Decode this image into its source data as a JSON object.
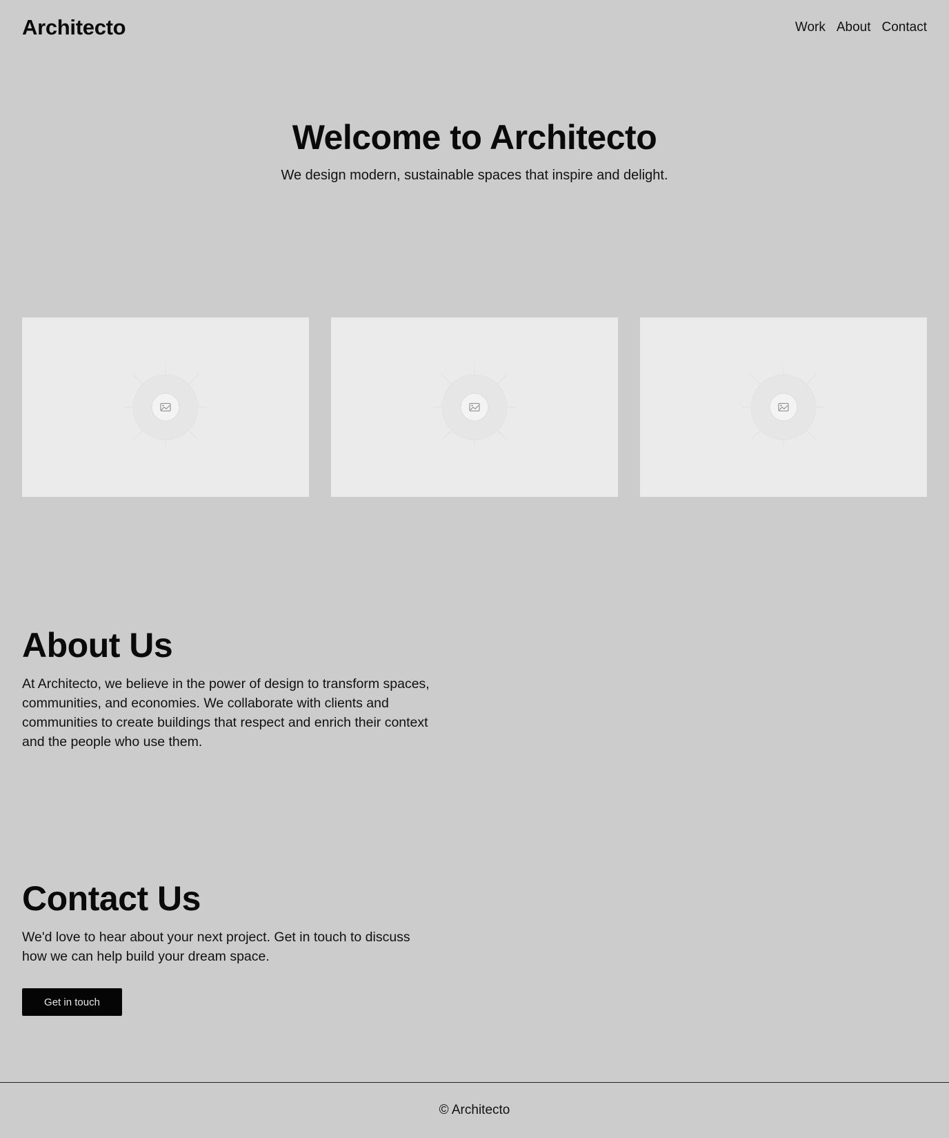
{
  "header": {
    "logo": "Architecto",
    "nav": [
      "Work",
      "About",
      "Contact"
    ]
  },
  "hero": {
    "title": "Welcome to Architecto",
    "subtitle": "We design modern, sustainable spaces that inspire and delight."
  },
  "gallery": {
    "items": [
      {
        "icon": "image-placeholder-icon"
      },
      {
        "icon": "image-placeholder-icon"
      },
      {
        "icon": "image-placeholder-icon"
      }
    ]
  },
  "about": {
    "title": "About Us",
    "body": "At Architecto, we believe in the power of design to transform spaces, communities, and economies. We collaborate with clients and communities to create buildings that respect and enrich their context and the people who use them."
  },
  "contact": {
    "title": "Contact Us",
    "body": "We'd love to hear about your next project. Get in touch to discuss how we can help build your dream space.",
    "button_label": "Get in touch"
  },
  "footer": {
    "text": "© Architecto"
  },
  "colors": {
    "background": "#cccccc",
    "card": "#ebebeb",
    "button": "#050505",
    "text": "#0a0a0a"
  }
}
